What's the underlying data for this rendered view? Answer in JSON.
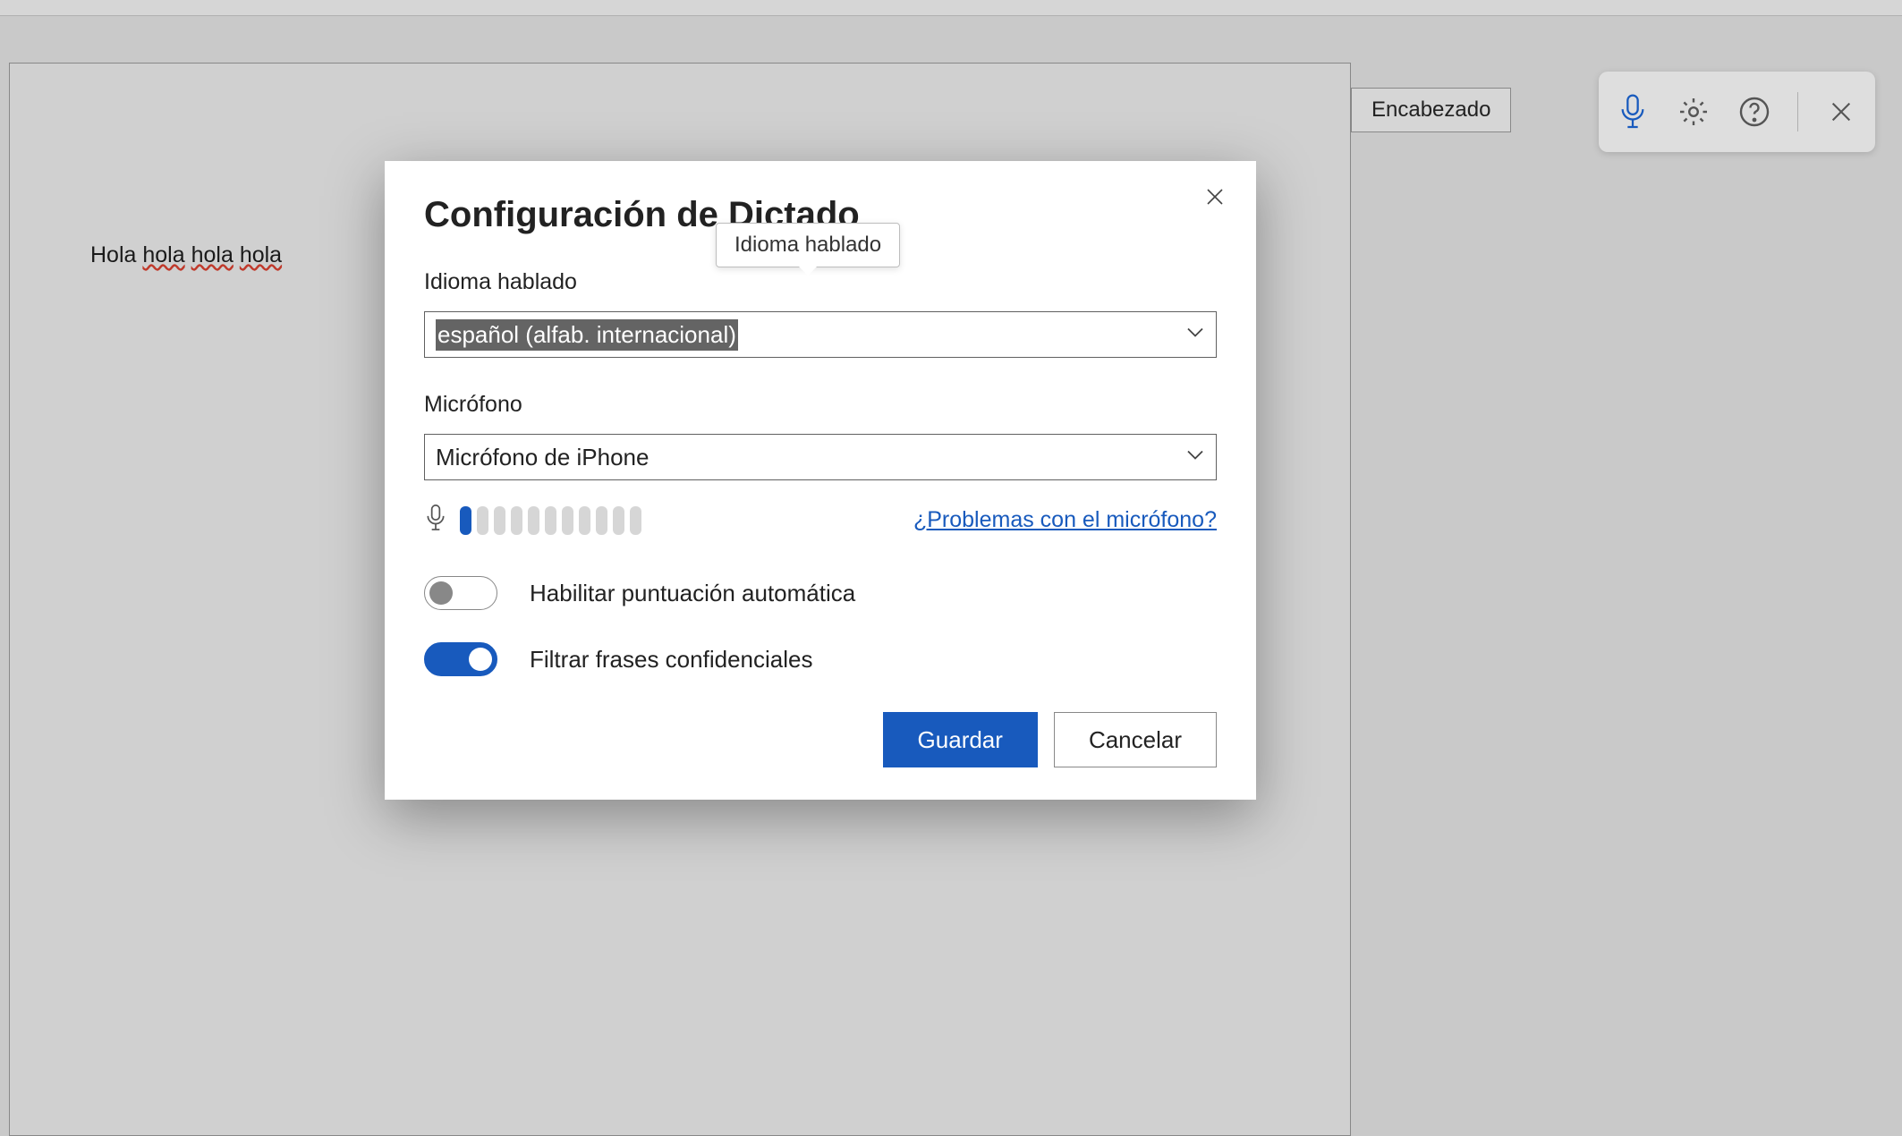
{
  "document": {
    "text_plain": "Hola",
    "text_misspelled": [
      "hola",
      "hola",
      "hola"
    ]
  },
  "style_dropdown": {
    "label": "Encabezado"
  },
  "modal": {
    "title": "Configuración de Dictado",
    "tooltip": "Idioma hablado",
    "language": {
      "label": "Idioma hablado",
      "value": "español (alfab. internacional)"
    },
    "mic": {
      "label": "Micrófono",
      "value": "Micrófono de iPhone",
      "help_link": "¿Problemas con el micrófono?",
      "level_active": 1,
      "level_total": 11
    },
    "toggles": {
      "auto_punct": {
        "label": "Habilitar puntuación automática",
        "on": false
      },
      "filter": {
        "label": "Filtrar frases confidenciales",
        "on": true
      }
    },
    "buttons": {
      "save": "Guardar",
      "cancel": "Cancelar"
    }
  }
}
